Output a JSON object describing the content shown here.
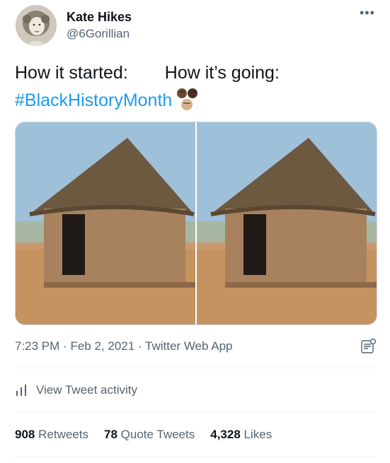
{
  "author": {
    "name": "Kate Hikes",
    "handle": "@6Gorillian",
    "avatar_icon": "vintage-portrait-avatar"
  },
  "menu_icon": "more-icon",
  "tweet": {
    "text_left": "How it started:",
    "text_right": "How it’s going:",
    "hashtag": "#BlackHistoryMonth",
    "emoji_icon": "raised-fists-emoji"
  },
  "media": {
    "images": [
      "thatched-hut-photo",
      "thatched-hut-photo"
    ]
  },
  "meta": {
    "time": "7:23 PM",
    "date": "Feb 2, 2021",
    "source": "Twitter Web App",
    "separator": "·"
  },
  "activity": {
    "label": "View Tweet activity",
    "icon": "bar-chart-icon"
  },
  "stats": {
    "retweets_count": "908",
    "retweets_label": "Retweets",
    "quotes_count": "78",
    "quotes_label": "Quote Tweets",
    "likes_count": "4,328",
    "likes_label": "Likes"
  },
  "colors": {
    "link": "#1d9bf0",
    "secondary_text": "#536471",
    "primary_text": "#0f1419",
    "divider": "#eff3f4"
  }
}
